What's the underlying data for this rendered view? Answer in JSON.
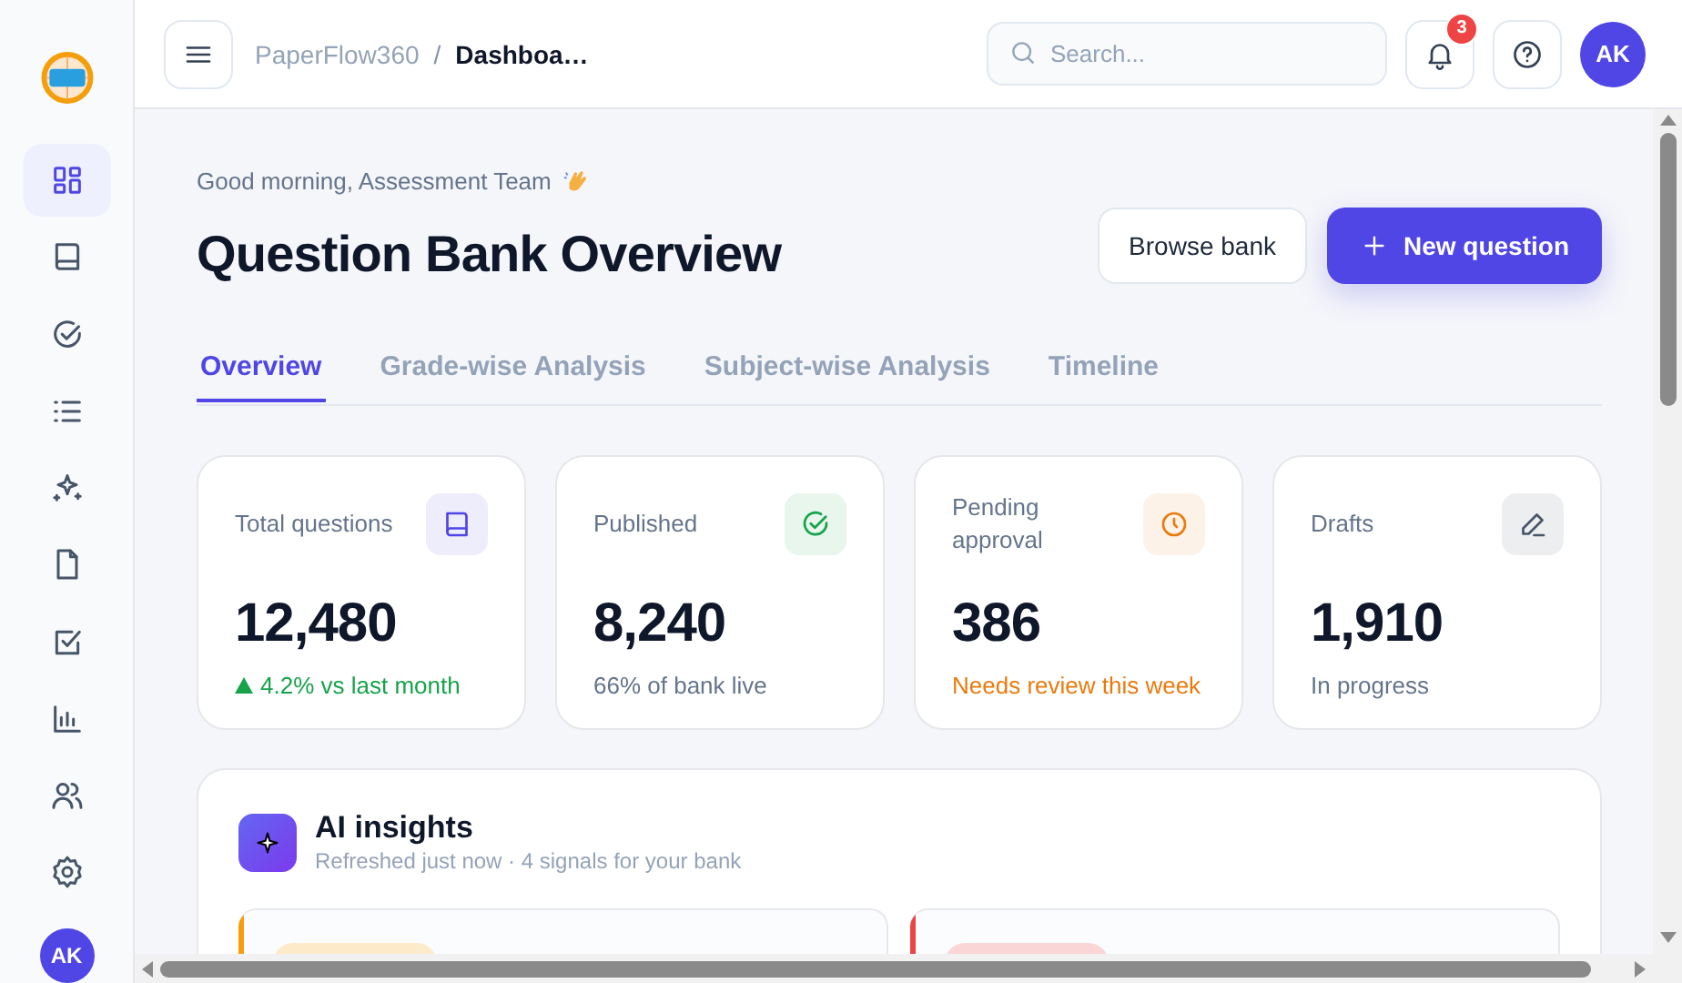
{
  "sidebar": {
    "items": [
      {
        "selected": true
      },
      {
        "selected": false
      },
      {
        "selected": false
      },
      {
        "selected": false
      },
      {
        "selected": false
      },
      {
        "selected": false
      },
      {
        "selected": false
      },
      {
        "selected": false
      },
      {
        "selected": false
      },
      {
        "selected": false
      }
    ],
    "avatar": "AK"
  },
  "topbar": {
    "breadcrumb": [
      "PaperFlow360",
      "Dashboa…"
    ],
    "breadcrumb_separator": "/",
    "search": {
      "placeholder": "Search..."
    },
    "notifications": "3",
    "avatar": "AK"
  },
  "header": {
    "greeting": "Good morning, Assessment Team",
    "title": "Question Bank Overview",
    "actions": [
      {
        "label": "Browse bank",
        "kind": "secondary"
      },
      {
        "label": "New question",
        "kind": "primary"
      }
    ]
  },
  "tabs": [
    {
      "label": "Overview",
      "selected": true
    },
    {
      "label": "Grade-wise Analysis",
      "selected": false
    },
    {
      "label": "Subject-wise Analysis",
      "selected": false
    },
    {
      "label": "Timeline",
      "selected": false
    }
  ],
  "stats": [
    {
      "label": "Total questions",
      "value": "12,480",
      "note": "4.2% vs last month",
      "kind": "up",
      "color": "#4f46e5"
    },
    {
      "label": "Published",
      "value": "8,240",
      "note": "66% of bank live",
      "kind": "neutral",
      "color": "#16a34a"
    },
    {
      "label": "Pending approval",
      "value": "386",
      "note": "Needs review this week",
      "kind": "warning",
      "color": "#ea7a0c"
    },
    {
      "label": "Drafts",
      "value": "1,910",
      "note": "In progress",
      "kind": "neutral",
      "color": "#475569"
    }
  ],
  "insights": {
    "title": "AI insights",
    "subtitle": "Refreshed just now · 4 signals for your bank",
    "items": [
      {
        "color": "#f59e0b"
      },
      {
        "color": "#ef4444"
      }
    ]
  }
}
